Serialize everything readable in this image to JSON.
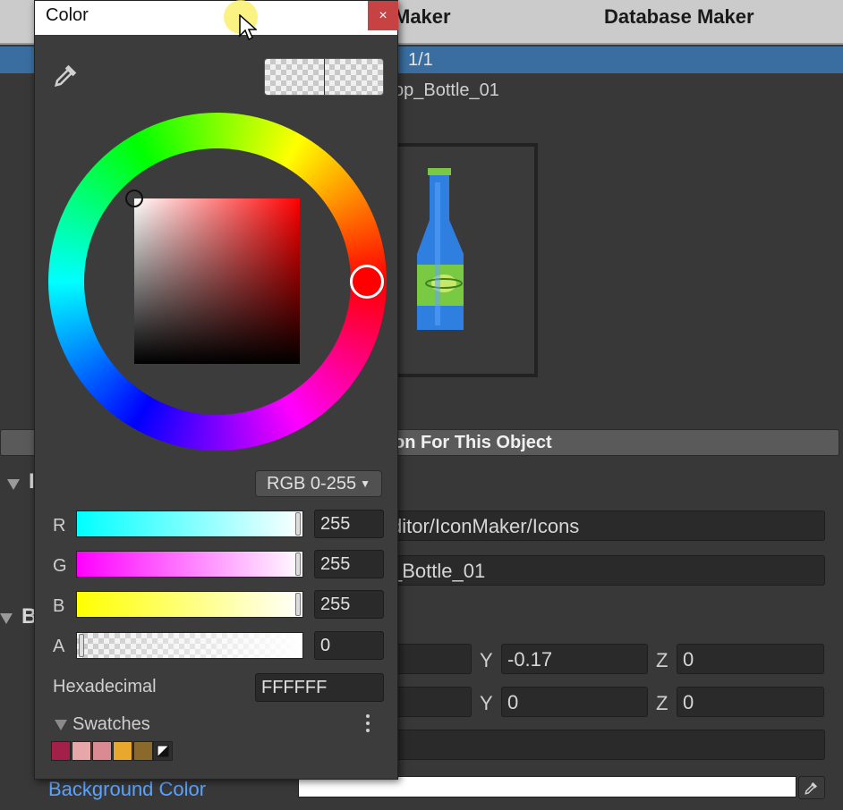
{
  "background_window": {
    "tabs": [
      "Maker",
      "Database Maker"
    ],
    "pager": "1/1",
    "object_name": "op_Bottle_01",
    "create_button_label": "on For This Object",
    "section_i_label": "I",
    "section_b_label": "B",
    "path_field": "ditor/IconMaker/Icons",
    "name_field": "_Bottle_01",
    "position": {
      "y_label": "Y",
      "y_value": "-0.17",
      "z_label": "Z",
      "z_value": "0"
    },
    "rotation": {
      "y_label": "Y",
      "y_value": "0",
      "z_label": "Z",
      "z_value": "0"
    },
    "background_color_label": "Background Color",
    "background_color_value": "#ffffff"
  },
  "color_picker": {
    "title": "Color",
    "close_glyph": "×",
    "mode": "RGB 0-255",
    "channels": [
      {
        "label": "R",
        "value": "255"
      },
      {
        "label": "G",
        "value": "255"
      },
      {
        "label": "B",
        "value": "255"
      },
      {
        "label": "A",
        "value": "0"
      }
    ],
    "hex_label": "Hexadecimal",
    "hex_value": "FFFFFF",
    "swatches_label": "Swatches",
    "swatch_colors": [
      "#a2204a",
      "#e7a7a8",
      "#d98b91",
      "#e8a82d",
      "#8a6a2c"
    ],
    "hue_color": "#ff0000",
    "current_color": "#ffffff",
    "current_alpha": 0
  },
  "icons": {
    "eyedropper": "eyedropper-icon",
    "close": "close-icon",
    "dropdown": "chevron-down-icon",
    "kebab": "kebab-menu-icon",
    "cursor": "mouse-cursor-icon",
    "bottle": "bottle-icon"
  }
}
